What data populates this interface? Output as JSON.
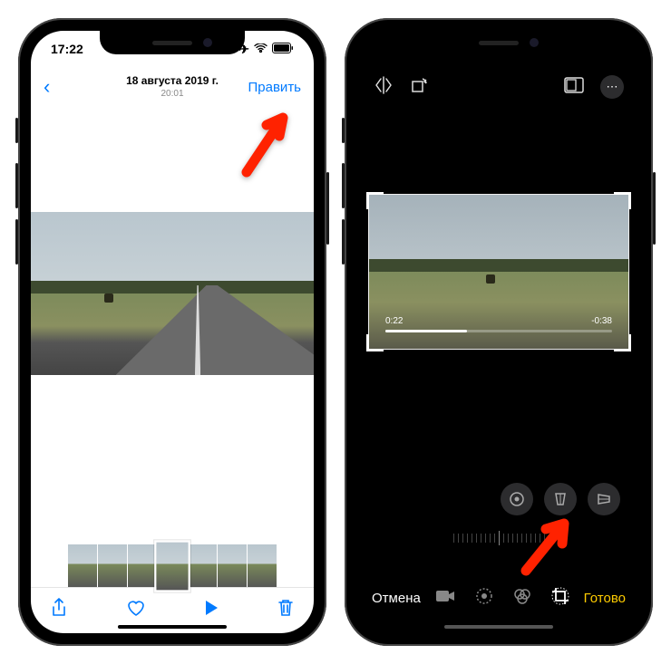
{
  "left": {
    "status": {
      "time": "17:22"
    },
    "nav": {
      "date": "18 августа 2019 г.",
      "time": "20:01",
      "edit": "Править"
    }
  },
  "right": {
    "video": {
      "elapsed": "0:22",
      "remaining": "-0:38"
    },
    "bottom": {
      "cancel": "Отмена",
      "done": "Готово"
    }
  }
}
